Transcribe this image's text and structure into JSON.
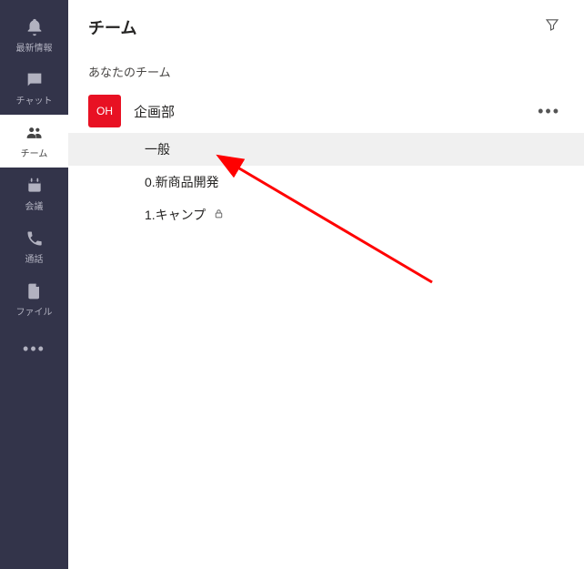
{
  "sidebar": {
    "items": [
      {
        "label": "最新情報",
        "icon": "bell-icon"
      },
      {
        "label": "チャット",
        "icon": "chat-icon"
      },
      {
        "label": "チーム",
        "icon": "teams-icon"
      },
      {
        "label": "会議",
        "icon": "calendar-icon"
      },
      {
        "label": "通話",
        "icon": "phone-icon"
      },
      {
        "label": "ファイル",
        "icon": "file-icon"
      }
    ],
    "active_index": 2
  },
  "header": {
    "title": "チーム"
  },
  "section": {
    "your_teams_label": "あなたのチーム"
  },
  "team": {
    "avatar_text": "OH",
    "avatar_color": "#e81123",
    "name": "企画部",
    "channels": [
      {
        "name": "一般",
        "private": false,
        "selected": true
      },
      {
        "name": "0.新商品開発",
        "private": false,
        "selected": false
      },
      {
        "name": "1.キャンプ",
        "private": true,
        "selected": false
      }
    ]
  },
  "arrow": {
    "color": "#ff0000"
  }
}
